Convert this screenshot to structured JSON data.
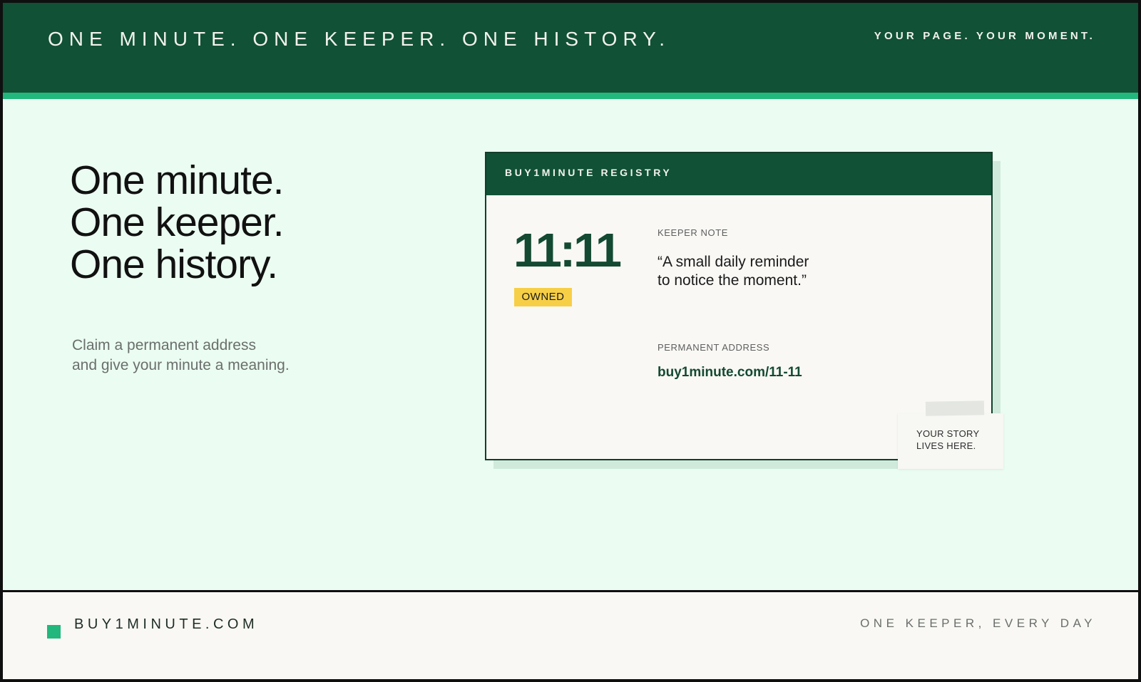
{
  "header": {
    "title": "ONE MINUTE. ONE KEEPER. ONE HISTORY.",
    "tagline": "YOUR PAGE. YOUR MOMENT."
  },
  "hero": {
    "headline": [
      "One minute.",
      "One keeper.",
      "One history."
    ],
    "subtext": [
      "Claim a permanent address",
      "and give your minute a meaning."
    ]
  },
  "registry_card": {
    "title": "BUY1MINUTE REGISTRY",
    "time": "11:11",
    "status": "OWNED",
    "note_label": "KEEPER NOTE",
    "note_lines": [
      "“A small daily reminder",
      "to notice the moment.”"
    ],
    "address_label": "PERMANENT ADDRESS",
    "address": "buy1minute.com/11-11",
    "sticky_note": [
      "YOUR STORY",
      "LIVES HERE."
    ]
  },
  "footer": {
    "brand": "BUY1MINUTE.COM",
    "tagline": "ONE KEEPER, EVERY DAY"
  },
  "colors": {
    "brand_dark_green": "#115135",
    "accent_green": "#22b77c",
    "mint_background": "#ebfcf2",
    "badge_yellow": "#f7cf46"
  }
}
